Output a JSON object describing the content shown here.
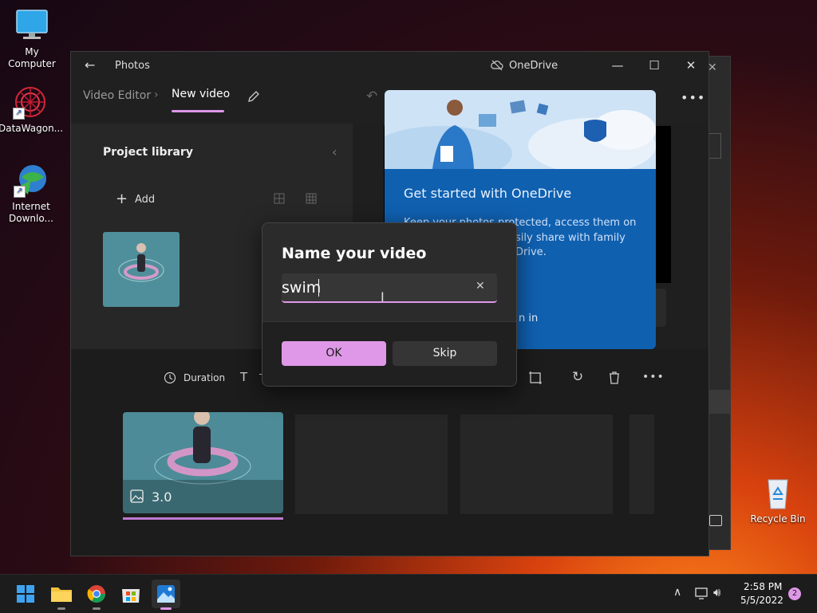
{
  "desktop": {
    "icons": [
      {
        "label": "My Computer"
      },
      {
        "label": "DataWagon..."
      },
      {
        "label": "Internet Downlo..."
      },
      {
        "label": "Recycle Bin"
      }
    ]
  },
  "window": {
    "app_title": "Photos",
    "onedrive_label": "OneDrive",
    "breadcrumb": {
      "root": "Video Editor",
      "current": "New video"
    }
  },
  "library": {
    "title": "Project library",
    "add_label": "Add"
  },
  "storyboard": {
    "duration_label": "Duration",
    "text_label": "T",
    "clip_duration": "3.0"
  },
  "onedrive_flyout": {
    "heading": "Get started with OneDrive",
    "body_line1": "Keep your photos protected, access them on",
    "body_line2": "sily share with family",
    "body_line3": "Drive.",
    "signin_label": "n in"
  },
  "dialog": {
    "title": "Name your video",
    "input_value": "swim",
    "ok_label": "OK",
    "skip_label": "Skip"
  },
  "taskbar": {
    "time": "2:58 PM",
    "date": "5/5/2022",
    "notification_count": "2"
  },
  "colors": {
    "accent": "#df98e8",
    "onedrive_blue": "#1060b0",
    "window_bg": "#1c1c1c"
  }
}
